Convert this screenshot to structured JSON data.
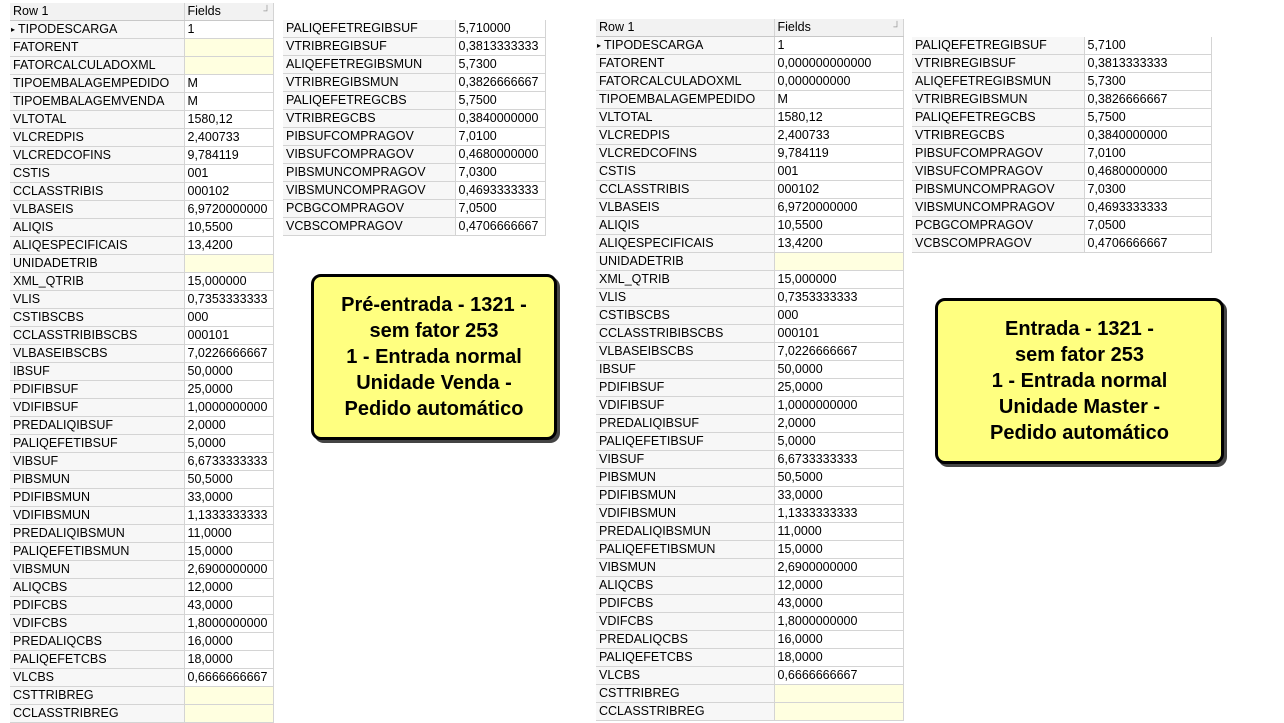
{
  "left_grid": {
    "header": {
      "col1": "Row 1",
      "col2": "Fields"
    },
    "rows": [
      {
        "n": "TIPODESCARGA",
        "v": "1"
      },
      {
        "n": "FATORENT",
        "v": ""
      },
      {
        "n": "FATORCALCULADOXML",
        "v": ""
      },
      {
        "n": "TIPOEMBALAGEMPEDIDO",
        "v": "M"
      },
      {
        "n": "TIPOEMBALAGEMVENDA",
        "v": "M"
      },
      {
        "n": "VLTOTAL",
        "v": "1580,12"
      },
      {
        "n": "VLCREDPIS",
        "v": "2,400733"
      },
      {
        "n": "VLCREDCOFINS",
        "v": "9,784119"
      },
      {
        "n": "CSTIS",
        "v": "001"
      },
      {
        "n": "CCLASSTRIBIS",
        "v": "000102"
      },
      {
        "n": "VLBASEIS",
        "v": "6,9720000000"
      },
      {
        "n": "ALIQIS",
        "v": "10,5500"
      },
      {
        "n": "ALIQESPECIFICAIS",
        "v": "13,4200"
      },
      {
        "n": "UNIDADETRIB",
        "v": ""
      },
      {
        "n": "XML_QTRIB",
        "v": "15,000000"
      },
      {
        "n": "VLIS",
        "v": "0,7353333333"
      },
      {
        "n": "CSTIBSCBS",
        "v": "000"
      },
      {
        "n": "CCLASSTRIBIBSCBS",
        "v": "000101"
      },
      {
        "n": "VLBASEIBSCBS",
        "v": "7,0226666667"
      },
      {
        "n": "IBSUF",
        "v": "50,0000"
      },
      {
        "n": "PDIFIBSUF",
        "v": "25,0000"
      },
      {
        "n": "VDIFIBSUF",
        "v": "1,0000000000"
      },
      {
        "n": "PREDALIQIBSUF",
        "v": "2,0000"
      },
      {
        "n": "PALIQEFETIBSUF",
        "v": "5,0000"
      },
      {
        "n": "VIBSUF",
        "v": "6,6733333333"
      },
      {
        "n": "PIBSMUN",
        "v": "50,5000"
      },
      {
        "n": "PDIFIBSMUN",
        "v": "33,0000"
      },
      {
        "n": "VDIFIBSMUN",
        "v": "1,1333333333"
      },
      {
        "n": "PREDALIQIBSMUN",
        "v": "11,0000"
      },
      {
        "n": "PALIQEFETIBSMUN",
        "v": "15,0000"
      },
      {
        "n": "VIBSMUN",
        "v": "2,6900000000"
      },
      {
        "n": "ALIQCBS",
        "v": "12,0000"
      },
      {
        "n": "PDIFCBS",
        "v": "43,0000"
      },
      {
        "n": "VDIFCBS",
        "v": "1,8000000000"
      },
      {
        "n": "PREDALIQCBS",
        "v": "16,0000"
      },
      {
        "n": "PALIQEFETCBS",
        "v": "18,0000"
      },
      {
        "n": "VLCBS",
        "v": "0,6666666667"
      },
      {
        "n": "CSTTRIBREG",
        "v": ""
      },
      {
        "n": "CCLASSTRIBREG",
        "v": ""
      }
    ]
  },
  "left_side": {
    "rows": [
      {
        "n": "PALIQEFETREGIBSUF",
        "v": "5,710000"
      },
      {
        "n": "VTRIBREGIBSUF",
        "v": "0,3813333333"
      },
      {
        "n": "ALIQEFETREGIBSMUN",
        "v": "5,7300"
      },
      {
        "n": "VTRIBREGIBSMUN",
        "v": "0,3826666667"
      },
      {
        "n": "PALIQEFETREGCBS",
        "v": "5,7500"
      },
      {
        "n": "VTRIBREGCBS",
        "v": "0,3840000000"
      },
      {
        "n": "PIBSUFCOMPRAGOV",
        "v": "7,0100"
      },
      {
        "n": "VIBSUFCOMPRAGOV",
        "v": "0,4680000000"
      },
      {
        "n": "PIBSMUNCOMPRAGOV",
        "v": "7,0300"
      },
      {
        "n": "VIBSMUNCOMPRAGOV",
        "v": "0,4693333333"
      },
      {
        "n": "PCBGCOMPRAGOV",
        "v": "7,0500"
      },
      {
        "n": "VCBSCOMPRAGOV",
        "v": "0,4706666667"
      }
    ]
  },
  "right_grid": {
    "header": {
      "col1": "Row 1",
      "col2": "Fields"
    },
    "rows": [
      {
        "n": "TIPODESCARGA",
        "v": "1"
      },
      {
        "n": "FATORENT",
        "v": "0,000000000000"
      },
      {
        "n": "FATORCALCULADOXML",
        "v": "0,000000000"
      },
      {
        "n": "TIPOEMBALAGEMPEDIDO",
        "v": "M"
      },
      {
        "n": "VLTOTAL",
        "v": "1580,12"
      },
      {
        "n": "VLCREDPIS",
        "v": "2,400733"
      },
      {
        "n": "VLCREDCOFINS",
        "v": "9,784119"
      },
      {
        "n": "CSTIS",
        "v": "001"
      },
      {
        "n": "CCLASSTRIBIS",
        "v": "000102"
      },
      {
        "n": "VLBASEIS",
        "v": "6,9720000000"
      },
      {
        "n": "ALIQIS",
        "v": "10,5500"
      },
      {
        "n": "ALIQESPECIFICAIS",
        "v": "13,4200"
      },
      {
        "n": "UNIDADETRIB",
        "v": ""
      },
      {
        "n": "XML_QTRIB",
        "v": "15,000000"
      },
      {
        "n": "VLIS",
        "v": "0,7353333333"
      },
      {
        "n": "CSTIBSCBS",
        "v": "000"
      },
      {
        "n": "CCLASSTRIBIBSCBS",
        "v": "000101"
      },
      {
        "n": "VLBASEIBSCBS",
        "v": "7,0226666667"
      },
      {
        "n": "IBSUF",
        "v": "50,0000"
      },
      {
        "n": "PDIFIBSUF",
        "v": "25,0000"
      },
      {
        "n": "VDIFIBSUF",
        "v": "1,0000000000"
      },
      {
        "n": "PREDALIQIBSUF",
        "v": "2,0000"
      },
      {
        "n": "PALIQEFETIBSUF",
        "v": "5,0000"
      },
      {
        "n": "VIBSUF",
        "v": "6,6733333333"
      },
      {
        "n": "PIBSMUN",
        "v": "50,5000"
      },
      {
        "n": "PDIFIBSMUN",
        "v": "33,0000"
      },
      {
        "n": "VDIFIBSMUN",
        "v": "1,1333333333"
      },
      {
        "n": "PREDALIQIBSMUN",
        "v": "11,0000"
      },
      {
        "n": "PALIQEFETIBSMUN",
        "v": "15,0000"
      },
      {
        "n": "VIBSMUN",
        "v": "2,6900000000"
      },
      {
        "n": "ALIQCBS",
        "v": "12,0000"
      },
      {
        "n": "PDIFCBS",
        "v": "43,0000"
      },
      {
        "n": "VDIFCBS",
        "v": "1,8000000000"
      },
      {
        "n": "PREDALIQCBS",
        "v": "16,0000"
      },
      {
        "n": "PALIQEFETCBS",
        "v": "18,0000"
      },
      {
        "n": "VLCBS",
        "v": "0,6666666667"
      },
      {
        "n": "CSTTRIBREG",
        "v": ""
      },
      {
        "n": "CCLASSTRIBREG",
        "v": ""
      }
    ]
  },
  "right_side": {
    "rows": [
      {
        "n": "PALIQEFETREGIBSUF",
        "v": "5,7100"
      },
      {
        "n": "VTRIBREGIBSUF",
        "v": "0,3813333333"
      },
      {
        "n": "ALIQEFETREGIBSMUN",
        "v": "5,7300"
      },
      {
        "n": "VTRIBREGIBSMUN",
        "v": "0,3826666667"
      },
      {
        "n": "PALIQEFETREGCBS",
        "v": "5,7500"
      },
      {
        "n": "VTRIBREGCBS",
        "v": "0,3840000000"
      },
      {
        "n": "PIBSUFCOMPRAGOV",
        "v": "7,0100"
      },
      {
        "n": "VIBSUFCOMPRAGOV",
        "v": "0,4680000000"
      },
      {
        "n": "PIBSMUNCOMPRAGOV",
        "v": "7,0300"
      },
      {
        "n": "VIBSMUNCOMPRAGOV",
        "v": "0,4693333333"
      },
      {
        "n": "PCBGCOMPRAGOV",
        "v": "7,0500"
      },
      {
        "n": "VCBSCOMPRAGOV",
        "v": "0,4706666667"
      }
    ]
  },
  "notes": {
    "left": [
      "Pré-entrada - 1321 -",
      "sem fator 253",
      "1 - Entrada normal",
      "Unidade Venda -",
      "Pedido automático"
    ],
    "right": [
      "Entrada - 1321 -",
      "sem fator 253",
      "1 - Entrada normal",
      "Unidade Master -",
      "Pedido automático"
    ]
  },
  "colors": {
    "note_bg": "#ffff80",
    "empty_cell": "#ffffe0",
    "grid_line": "#d4d4d4"
  }
}
